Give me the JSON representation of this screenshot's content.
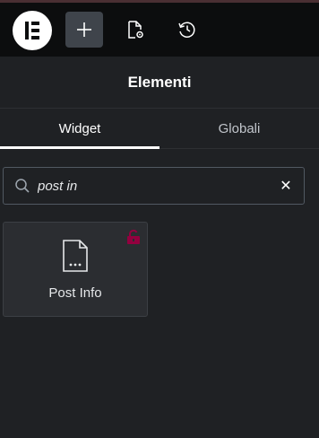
{
  "toolbar": {
    "logo_icon": "elementor-logo-icon",
    "add_button_icon": "plus-icon",
    "page_settings_icon": "page-settings-icon",
    "history_icon": "history-icon"
  },
  "panel": {
    "title": "Elementi"
  },
  "tabs": [
    {
      "label": "Widget",
      "active": true
    },
    {
      "label": "Globali",
      "active": false
    }
  ],
  "search": {
    "value": "post in",
    "clear_label": "✕"
  },
  "widgets": [
    {
      "label": "Post Info",
      "icon": "post-info-icon",
      "pro": true
    }
  ],
  "colors": {
    "pro_accent": "#93003f",
    "background": "#1f2124",
    "topbar": "#0c0d0e"
  }
}
